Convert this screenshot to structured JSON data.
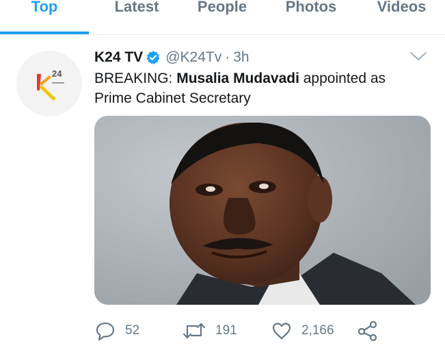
{
  "tabs": [
    {
      "label": "Top",
      "active": true
    },
    {
      "label": "Latest",
      "active": false
    },
    {
      "label": "People",
      "active": false
    },
    {
      "label": "Photos",
      "active": false
    },
    {
      "label": "Videos",
      "active": false
    }
  ],
  "tweet": {
    "avatar": {
      "logo_text": "24",
      "icon": "k24-logo"
    },
    "author_name": "K24 TV",
    "verified": true,
    "handle": "@K24Tv",
    "separator": "·",
    "time": "3h",
    "text_prefix": "BREAKING: ",
    "text_bold": "Musalia Mudavadi",
    "text_suffix": " appointed as Prime Cabinet Secretary",
    "photo": {
      "icon": "portrait-photo"
    },
    "stats": {
      "replies": "52",
      "retweets": "191",
      "likes": "2,166"
    }
  },
  "colors": {
    "accent": "#1da1f2",
    "muted": "#657786",
    "divider": "#e6ecf0"
  }
}
